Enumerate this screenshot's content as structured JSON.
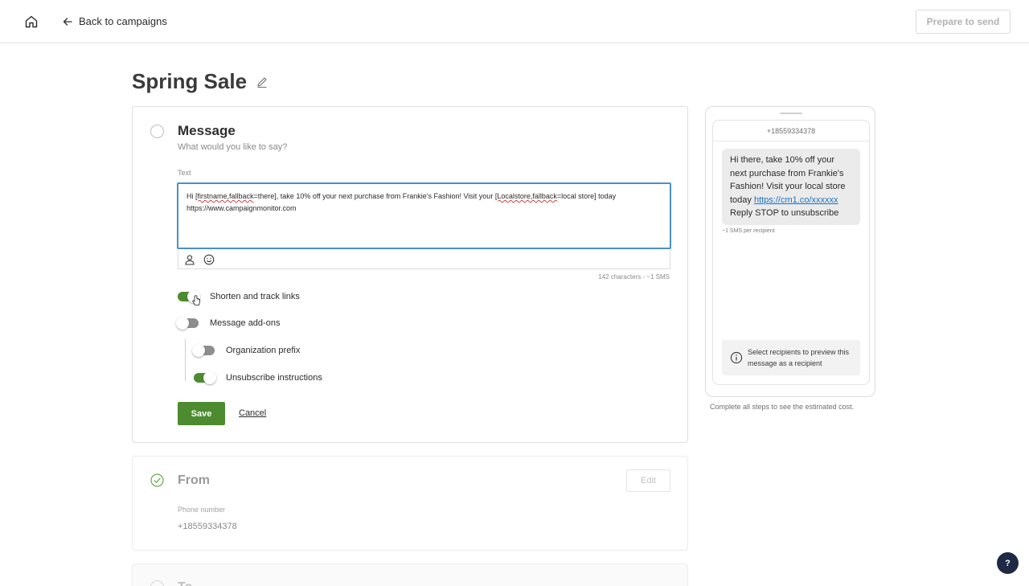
{
  "header": {
    "home_icon": "home-icon",
    "back_label": "Back to campaigns",
    "prepare_label": "Prepare to send"
  },
  "page": {
    "title": "Spring Sale",
    "edit_icon": "pencil-icon"
  },
  "message": {
    "title": "Message",
    "subtitle": "What would you like to say?",
    "text_label": "Text",
    "text_segments": [
      "Hi ",
      "[firstname,fallback",
      "=there], take 10% off your next purchase from Frankie's Fashion! Visit your ",
      "[Localstore,fallback",
      "=local store] today",
      "https://www.campaignmonitor.com"
    ],
    "char_count": "142 characters - ~1 SMS",
    "toggles": {
      "shorten_label": "Shorten and track links",
      "shorten_on": true,
      "addons_label": "Message add-ons",
      "addons_on": false,
      "org_prefix_label": "Organization prefix",
      "org_prefix_on": false,
      "unsubscribe_label": "Unsubscribe instructions",
      "unsubscribe_on": true
    },
    "save_label": "Save",
    "cancel_label": "Cancel"
  },
  "from": {
    "title": "From",
    "edit_label": "Edit",
    "phone_label": "Phone number",
    "phone_value": "+18559334378"
  },
  "to": {
    "title": "To"
  },
  "preview": {
    "phone_number": "+18559334378",
    "bubble_text_before": "Hi there, take 10% off your next purchase from Frankie's Fashion! Visit your local store today ",
    "bubble_link": "https://cm1.co/xxxxxx",
    "bubble_text_after": " Reply STOP to unsubscribe",
    "sms_per": "~1 SMS per recipient",
    "info_text": "Select recipients to preview this message as a recipient",
    "estimated_cost_note": "Complete all steps to see the estimated cost."
  },
  "help_label": "?",
  "colors": {
    "accent_green": "#4d8b31",
    "focus_blue": "#4a90c9",
    "link_blue": "#1a6fc4",
    "help_navy": "#1e2a44"
  }
}
